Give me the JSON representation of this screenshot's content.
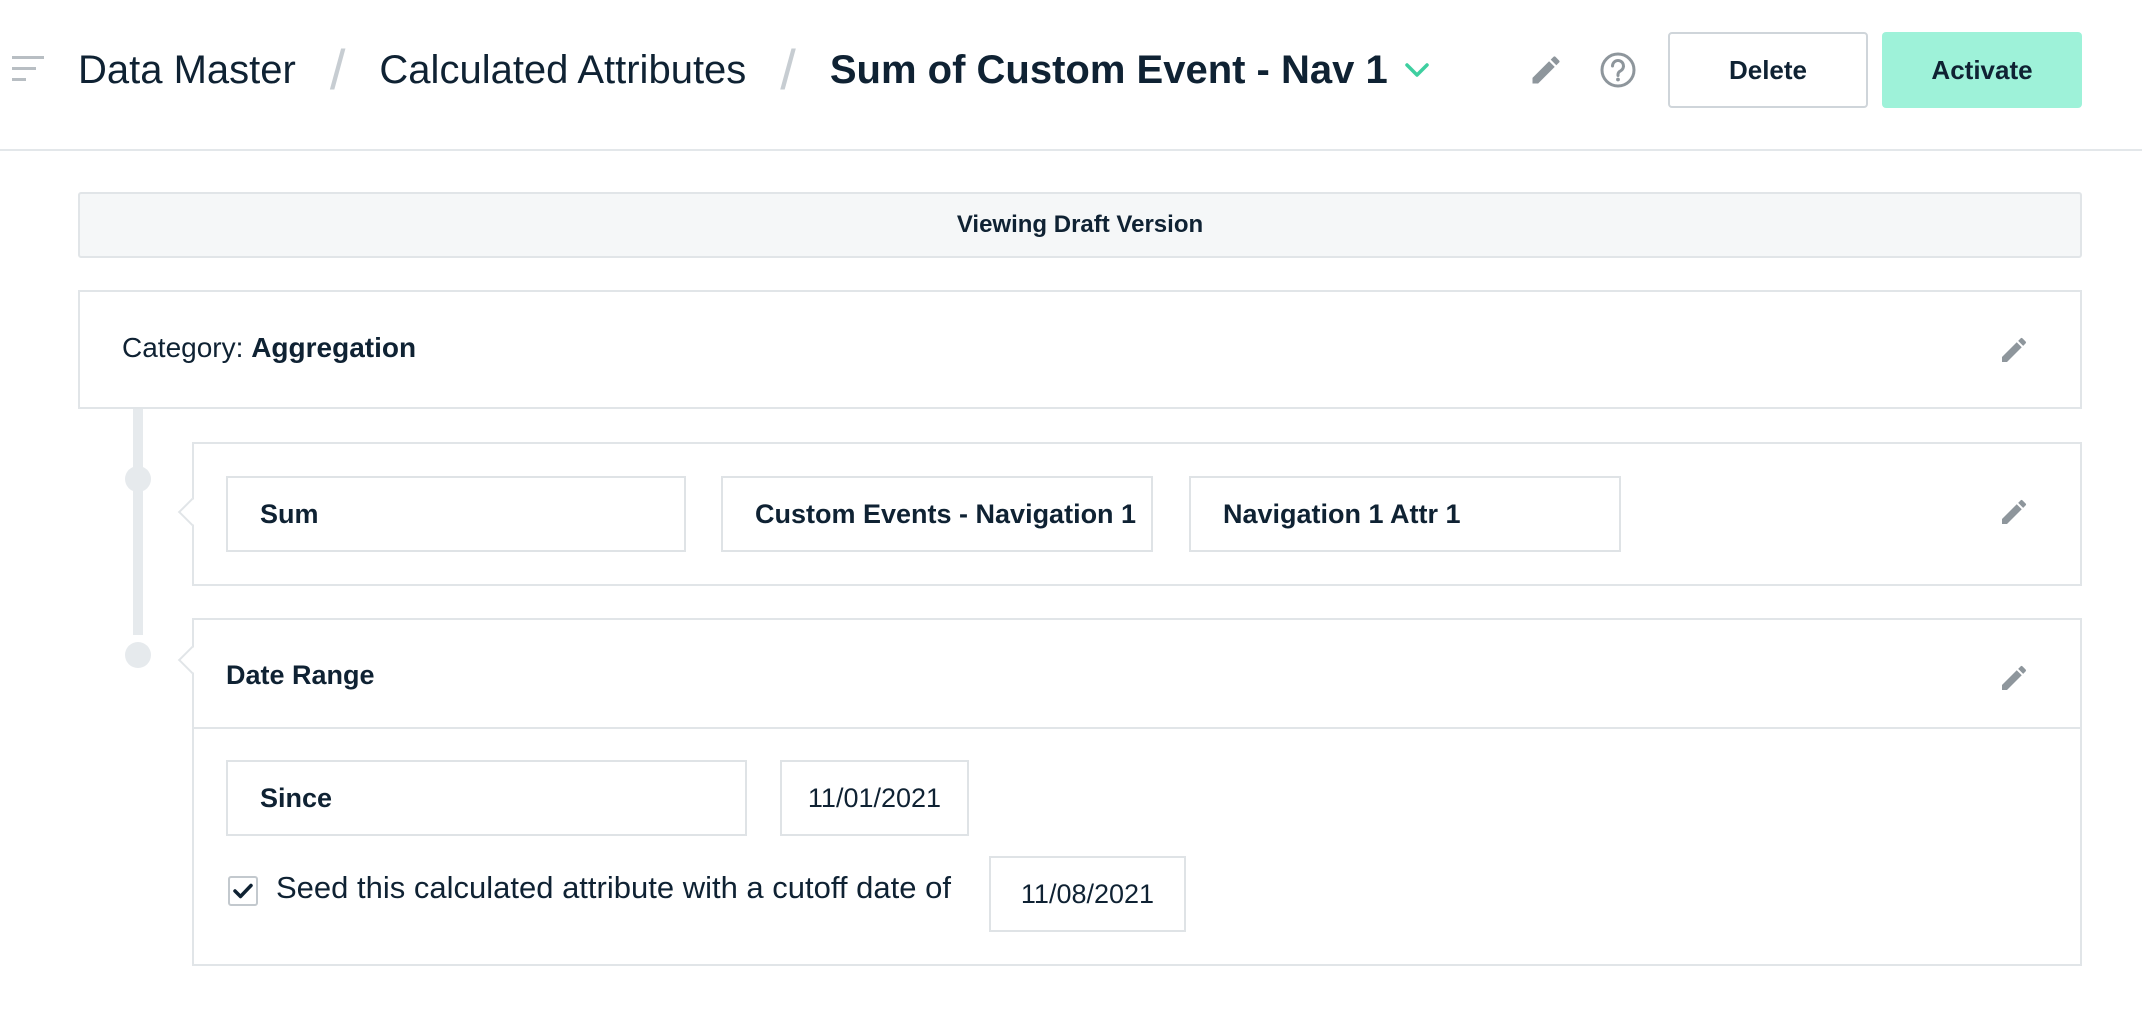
{
  "header": {
    "breadcrumb": {
      "root": "Data Master",
      "section": "Calculated Attributes",
      "current": "Sum of Custom Event - Nav 1"
    },
    "buttons": {
      "delete": "Delete",
      "activate": "Activate"
    },
    "icons": [
      "menu-icon",
      "chevron-down-icon",
      "pencil-icon",
      "help-icon"
    ]
  },
  "banner": {
    "text": "Viewing Draft Version"
  },
  "category": {
    "label": "Category:",
    "value": "Aggregation"
  },
  "aggregation": {
    "function": "Sum",
    "event": "Custom Events - Navigation 1",
    "attribute": "Navigation 1 Attr 1"
  },
  "date_range": {
    "title": "Date Range",
    "mode": "Since",
    "since_date": "11/01/2021",
    "seed_checked": true,
    "seed_label": "Seed this calculated attribute with a cutoff date of",
    "cutoff_date": "11/08/2021"
  },
  "colors": {
    "accent": "#3ecfa0",
    "activate_bg": "#9ef2d9",
    "text": "#0f2233",
    "border": "#e1e5e8",
    "icon_gray": "#8e969c"
  }
}
